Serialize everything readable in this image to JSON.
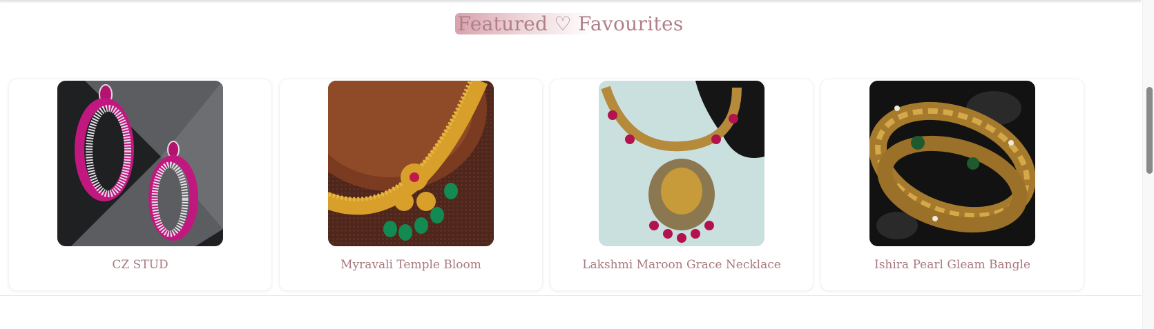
{
  "section": {
    "title": "Featured ♡ Favourites"
  },
  "products": [
    {
      "name": "CZ STUD",
      "icon": "earrings-image"
    },
    {
      "name": "Myravali Temple Bloom",
      "icon": "necklace-image"
    },
    {
      "name": "Lakshmi Maroon Grace Necklace",
      "icon": "necklace-image"
    },
    {
      "name": "Ishira Pearl Gleam Bangle",
      "icon": "bangle-image"
    }
  ],
  "colors": {
    "accent": "#b07f88",
    "label": "#a8787f"
  }
}
